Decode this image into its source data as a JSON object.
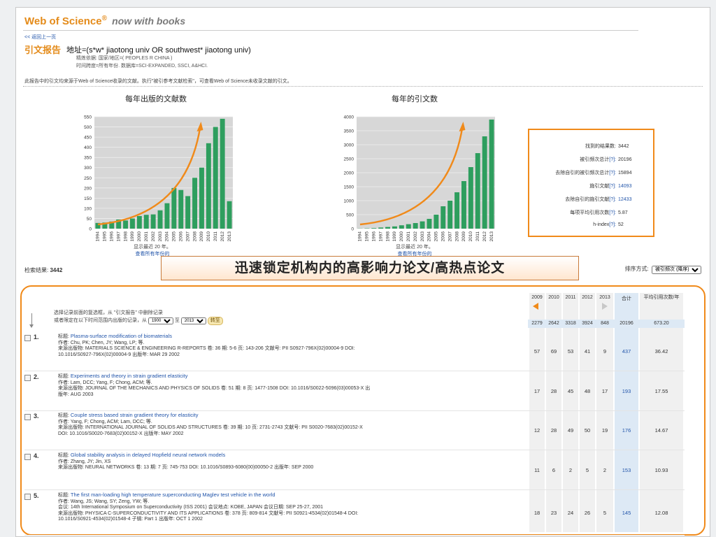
{
  "header": {
    "logo_main": "Web of Science",
    "logo_reg": "®",
    "logo_suffix": "now with books",
    "back_link": "<< 返回上一页"
  },
  "report": {
    "title": "引文报告",
    "query": "地址=(s*w* jiaotong univ OR southwest* jiaotong univ)",
    "refine": "精炼依据: 国家/地区=( PEOPLES R CHINA )",
    "timespan": "时间跨度=所有年份. 数据库=SCI-EXPANDED, SSCI, A&HCI.",
    "note": "此报告中的引文均来源于Web of Science收录的文献。执行\"被引参考文献检索\"，可查看Web of Science未收录文献的引文。"
  },
  "charts_meta": {
    "shown_note": "显示最近 20 年。",
    "all_years_link": "查看所有年份的"
  },
  "chart_data": [
    {
      "type": "bar",
      "title": "每年出版的文献数",
      "categories": [
        "1994",
        "1995",
        "1996",
        "1997",
        "1998",
        "1999",
        "2000",
        "2001",
        "2002",
        "2003",
        "2004",
        "2005",
        "2006",
        "2007",
        "2008",
        "2009",
        "2010",
        "2011",
        "2012",
        "2013"
      ],
      "values": [
        28,
        30,
        35,
        45,
        40,
        50,
        62,
        68,
        70,
        90,
        125,
        200,
        190,
        160,
        250,
        300,
        420,
        500,
        540,
        135
      ],
      "ylim": [
        0,
        550
      ],
      "yticks": [
        0,
        50,
        100,
        150,
        200,
        250,
        300,
        350,
        400,
        450,
        500,
        550
      ],
      "color": "#2e9e5e",
      "annotation": "orange growth curve"
    },
    {
      "type": "bar",
      "title": "每年的引文数",
      "categories": [
        "1994",
        "1995",
        "1996",
        "1997",
        "1998",
        "1999",
        "2000",
        "2001",
        "2002",
        "2003",
        "2004",
        "2005",
        "2006",
        "2007",
        "2008",
        "2009",
        "2010",
        "2011",
        "2012",
        "2013"
      ],
      "values": [
        5,
        10,
        20,
        40,
        60,
        80,
        120,
        160,
        200,
        260,
        350,
        500,
        800,
        1000,
        1300,
        1700,
        2200,
        2700,
        3300,
        3900
      ],
      "ylim": [
        0,
        4000
      ],
      "yticks": [
        0,
        500,
        1000,
        1500,
        2000,
        2500,
        3000,
        3500,
        4000
      ],
      "color": "#2e9e5e",
      "annotation": "orange growth curve"
    }
  ],
  "stats": [
    {
      "label": "找到的结果数:",
      "value": "3442",
      "help": "",
      "link": false
    },
    {
      "label": "被引频次总计",
      "help": "[?]",
      "value": "20196",
      "link": false
    },
    {
      "label": "去除自引的被引频次总计",
      "help": "[?]",
      "value": "15894",
      "link": false
    },
    {
      "label": "施引文献",
      "help": "[?]",
      "value": "14093",
      "link": true
    },
    {
      "label": "去除自引的施引文献",
      "help": "[?]",
      "value": "12433",
      "link": true
    },
    {
      "label": "每项平均引用次数",
      "help": "[?]",
      "value": "5.87",
      "link": false
    },
    {
      "label": "h-index",
      "help": "[?]",
      "value": "52",
      "link": false
    }
  ],
  "results": {
    "label": "检索结果:",
    "count": "3442",
    "sort_label": "排序方式:",
    "sort_value": "被引频次 (降序)"
  },
  "banner": "迅速锁定机构内的高影响力论文/高热点论文",
  "selection": {
    "line1": "选择记录前面的复选框，从 \"引文报告\" 中删除记录",
    "line2_pre": "或者限定在以下时间范围内出版的记录，从",
    "from_year": "1900",
    "to_word": "至",
    "to_year": "2013",
    "go": "转至"
  },
  "table": {
    "years": [
      "2009",
      "2010",
      "2011",
      "2012",
      "2013"
    ],
    "total_header": "合计",
    "avg_header": "平均引用次数/年",
    "totals": [
      "2279",
      "2642",
      "3318",
      "3924",
      "848",
      "20196",
      "673.20"
    ]
  },
  "records": [
    {
      "n": "1.",
      "title_label": "标题:",
      "title": "Plasma-surface modification of biomaterials",
      "authors": "作者: Chu, PK; Chen, JY; Wang, LP; 等.",
      "source": "来源出版物: MATERIALS SCIENCE & ENGINEERING R-REPORTS  卷: 36  期: 5-6  页: 143-206  文献号: PII S0927-796X(02)00004-9  DOI:",
      "extra": "10.1016/S0927-796X(02)00004-9  出版年: MAR 29 2002",
      "counts": [
        "57",
        "69",
        "53",
        "41",
        "9",
        "437",
        "36.42"
      ]
    },
    {
      "n": "2.",
      "title_label": "标题:",
      "title": "Experiments and theory in strain gradient elasticity",
      "authors": "作者: Lam, DCC; Yang, F; Chong, ACM; 等.",
      "source": "来源出版物: JOURNAL OF THE MECHANICS AND PHYSICS OF SOLIDS  卷: 51  期: 8  页: 1477-1508  DOI: 10.1016/S0022-5096(03)00053-X  出",
      "extra": "版年: AUG 2003",
      "counts": [
        "17",
        "28",
        "45",
        "48",
        "17",
        "193",
        "17.55"
      ]
    },
    {
      "n": "3.",
      "title_label": "标题:",
      "title": "Couple stress based strain gradient theory for elasticity",
      "authors": "作者: Yang, F; Chong, ACM; Lam, DCC; 等.",
      "source": "来源出版物: INTERNATIONAL JOURNAL OF SOLIDS AND STRUCTURES  卷: 39  期: 10  页: 2731-2743  文献号: PII S0020-7683(02)00152-X",
      "extra": "DOI: 10.1016/S0020-7683(02)00152-X  出版年: MAY 2002",
      "counts": [
        "12",
        "28",
        "49",
        "50",
        "19",
        "176",
        "14.67"
      ]
    },
    {
      "n": "4.",
      "title_label": "标题:",
      "title": "Global stability analysis in delayed Hopfield neural network models",
      "authors": "作者: Zhang, JY; Jin, XS",
      "source": "来源出版物: NEURAL NETWORKS  卷: 13  期: 7  页: 745-753  DOI: 10.1016/S0893-6080(00)00050-2  出版年: SEP 2000",
      "extra": "",
      "counts": [
        "11",
        "6",
        "2",
        "5",
        "2",
        "153",
        "10.93"
      ]
    },
    {
      "n": "5.",
      "title_label": "标题:",
      "title": "The first man-loading high temperature superconducting Maglev test vehicle in the world",
      "authors": "作者: Wang, JS; Wang, SY; Zeng, YW; 等.",
      "source": "会议: 14th International Symposium on Superconductivity (ISS 2001) 会议地点: KOBE, JAPAN 会议日期: SEP 25-27, 2001",
      "extra": "来源出版物: PHYSICA C-SUPERCONDUCTIVITY AND ITS APPLICATIONS  卷: 378  页: 809-814  文献号: PII S0921-4534(02)01548-4  DOI:",
      "extra2": "10.1016/S0921-4534(02)01548-4  子辑: Part 1  出版年: OCT 1 2002",
      "counts": [
        "18",
        "23",
        "24",
        "26",
        "5",
        "145",
        "12.08"
      ]
    }
  ]
}
